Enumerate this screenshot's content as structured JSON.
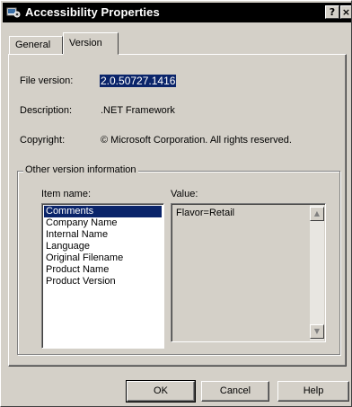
{
  "window": {
    "title": "Accessibility Properties",
    "icon": "accessibility-icon",
    "help_button": "?",
    "close_button": "×"
  },
  "tabs": [
    {
      "label": "General",
      "active": false
    },
    {
      "label": "Version",
      "active": true
    }
  ],
  "version_info": {
    "file_version_label": "File version:",
    "file_version_value": "2.0.50727.1416",
    "description_label": "Description:",
    "description_value": ".NET Framework",
    "copyright_label": "Copyright:",
    "copyright_value": "© Microsoft Corporation.  All rights reserved."
  },
  "other_info": {
    "group_label": "Other version information",
    "item_name_label": "Item name:",
    "value_label": "Value:",
    "items": [
      "Comments",
      "Company Name",
      "Internal Name",
      "Language",
      "Original Filename",
      "Product Name",
      "Product Version"
    ],
    "selected_item": "Comments",
    "value_text": "Flavor=Retail"
  },
  "buttons": {
    "ok": "OK",
    "cancel": "Cancel",
    "help": "Help"
  },
  "colors": {
    "dialog_face": "#d4d0c8",
    "titlebar": "#000000",
    "selection": "#0a246a"
  }
}
